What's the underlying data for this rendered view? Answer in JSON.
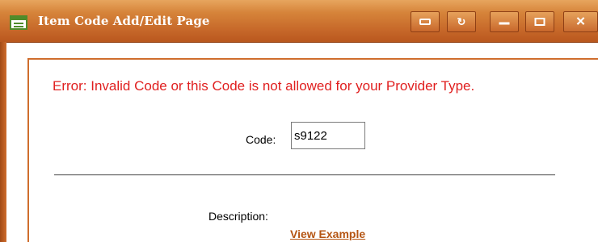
{
  "window": {
    "title": "Item Code Add/Edit Page",
    "controls": {
      "pin": "pin-icon",
      "refresh": "refresh-icon",
      "minimize": "minimize-icon",
      "maximize": "maximize-icon",
      "close": "close-icon"
    }
  },
  "form": {
    "error_message": "Error: Invalid Code or this Code is not allowed for your Provider Type.",
    "code_label": "Code:",
    "code_value": "s9122",
    "description_label": "Description:",
    "view_example_link": "View Example"
  },
  "colors": {
    "titlebar": "#c96b2e",
    "error": "#e01f1f",
    "link": "#b55513"
  }
}
